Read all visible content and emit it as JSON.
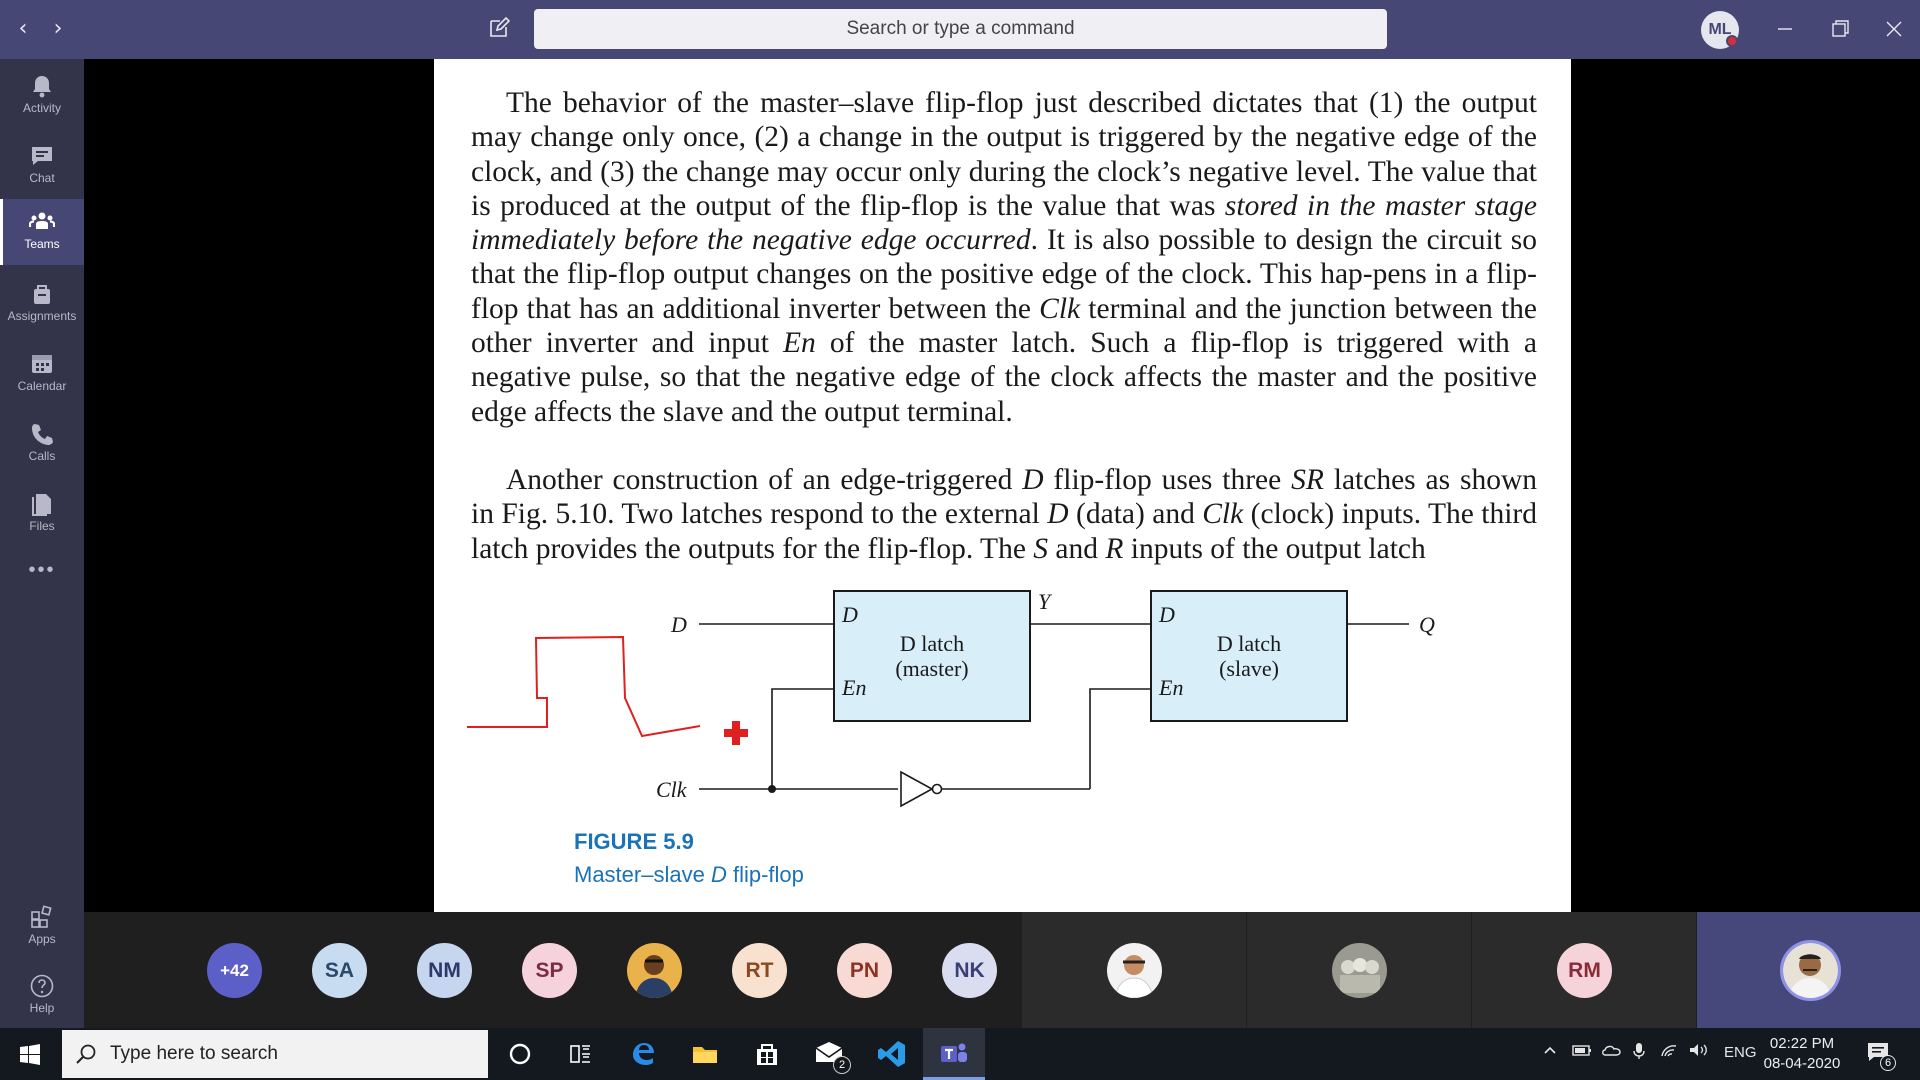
{
  "titlebar": {
    "back_label": "‹",
    "forward_label": "›",
    "search_placeholder": "Search or type a command",
    "user_initials": "ML"
  },
  "rail": {
    "items": [
      {
        "label": "Activity",
        "icon": "bell-icon"
      },
      {
        "label": "Chat",
        "icon": "chat-icon"
      },
      {
        "label": "Teams",
        "icon": "teams-icon",
        "active": true
      },
      {
        "label": "Assignments",
        "icon": "assignments-icon"
      },
      {
        "label": "Calendar",
        "icon": "calendar-icon"
      },
      {
        "label": "Calls",
        "icon": "phone-icon"
      },
      {
        "label": "Files",
        "icon": "files-icon"
      }
    ],
    "more_label": "•••",
    "apps_label": "Apps",
    "help_label": "Help"
  },
  "document": {
    "paragraph1": [
      {
        "t": "The behavior of the master–slave flip-flop just described dictates that (1) the output may change only once, (2) a change in the output is triggered by the negative edge of the clock, and (3) the change may occur only during the clock’s negative level. The value that is produced at the output of the flip-flop is the value that was "
      },
      {
        "t": "stored in the master stage immediately before the negative edge occurred",
        "i": true
      },
      {
        "t": ". It is also possible to design the circuit so that the flip-flop output changes on the positive edge of the clock. This hap-pens in a flip-flop that has an additional inverter between the "
      },
      {
        "t": "Clk",
        "i": true
      },
      {
        "t": " terminal and the junction between the other inverter and input "
      },
      {
        "t": "En",
        "i": true
      },
      {
        "t": " of the master latch. Such a flip-flop is triggered with a negative pulse, so that the negative edge of the clock affects the master and the positive edge affects the slave and the output terminal."
      }
    ],
    "paragraph2": [
      {
        "t": "Another construction of an edge-triggered "
      },
      {
        "t": "D",
        "i": true
      },
      {
        "t": " flip-flop uses three "
      },
      {
        "t": "SR",
        "i": true
      },
      {
        "t": " latches as shown in Fig. 5.10. Two latches respond to the external "
      },
      {
        "t": "D",
        "i": true
      },
      {
        "t": " (data) and "
      },
      {
        "t": "Clk",
        "i": true
      },
      {
        "t": " (clock) inputs. The third latch provides the outputs for the flip-flop. The "
      },
      {
        "t": "S",
        "i": true
      },
      {
        "t": " and "
      },
      {
        "t": "R",
        "i": true
      },
      {
        "t": " inputs of the output latch"
      }
    ],
    "diagram": {
      "input_d": "D",
      "input_clk": "Clk",
      "master_d": "D",
      "master_en": "En",
      "master_title": "D latch",
      "master_sub": "(master)",
      "slave_d": "D",
      "slave_en": "En",
      "slave_title": "D latch",
      "slave_sub": "(slave)",
      "wire_y": "Y",
      "output_q": "Q"
    },
    "figure_label": "FIGURE 5.9",
    "figure_title_pre": "Master–slave ",
    "figure_title_it": "D",
    "figure_title_post": " flip-flop",
    "annotation_color": "#e02020"
  },
  "participants": [
    {
      "initials": "+42",
      "bg": "#5b5fc7",
      "fg": "#ffffff"
    },
    {
      "initials": "SA",
      "bg": "#c7dcf0",
      "fg": "#2b4a6b"
    },
    {
      "initials": "NM",
      "bg": "#c7d6ef",
      "fg": "#2b3a6b"
    },
    {
      "initials": "SP",
      "bg": "#f6d3dc",
      "fg": "#7a2b45"
    },
    {
      "initials": "",
      "photo": true
    },
    {
      "initials": "RT",
      "bg": "#f9e1d0",
      "fg": "#8a4a1f"
    },
    {
      "initials": "PN",
      "bg": "#f8d9d3",
      "fg": "#8a3324"
    },
    {
      "initials": "NK",
      "bg": "#dadcef",
      "fg": "#3b3f73"
    },
    {
      "initials": "",
      "photo": true
    },
    {
      "initials": "",
      "photo": true
    },
    {
      "initials": "RM",
      "bg": "#f6d3d8",
      "fg": "#8a2b3a"
    },
    {
      "initials": "",
      "photo": true,
      "self": true
    }
  ],
  "taskbar": {
    "search_placeholder": "Type here to search",
    "mail_badge": "2",
    "lang": "ENG",
    "time": "02:22 PM",
    "date": "08-04-2020",
    "notif_count": "6"
  }
}
